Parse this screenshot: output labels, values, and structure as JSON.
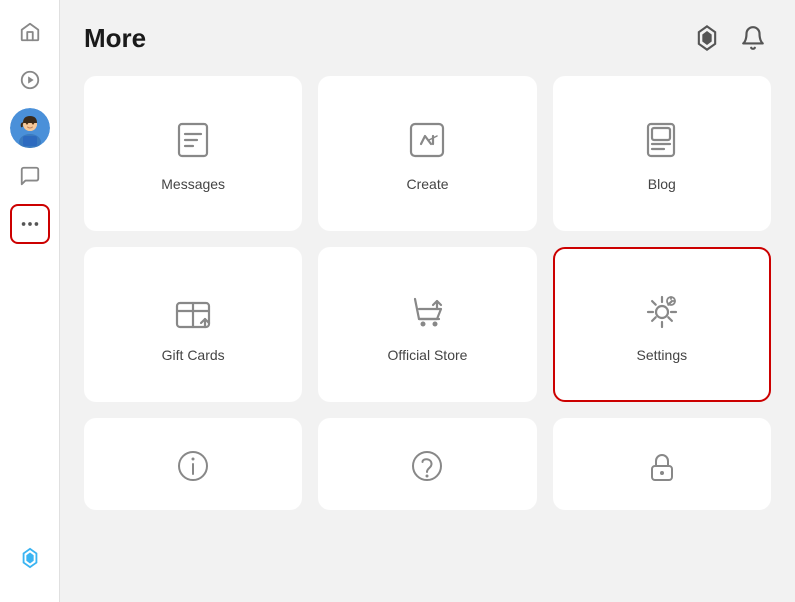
{
  "header": {
    "title": "More"
  },
  "sidebar": {
    "items": [
      {
        "name": "home",
        "label": "Home"
      },
      {
        "name": "discover",
        "label": "Discover"
      },
      {
        "name": "avatar",
        "label": "Avatar"
      },
      {
        "name": "chat",
        "label": "Chat"
      },
      {
        "name": "more",
        "label": "More"
      }
    ],
    "bottom": [
      {
        "name": "robux",
        "label": "Robux"
      }
    ]
  },
  "grid": {
    "cards": [
      {
        "id": "messages",
        "label": "Messages",
        "icon": "messages-icon",
        "highlighted": false
      },
      {
        "id": "create",
        "label": "Create",
        "icon": "create-icon",
        "highlighted": false
      },
      {
        "id": "blog",
        "label": "Blog",
        "icon": "blog-icon",
        "highlighted": false
      },
      {
        "id": "gift-cards",
        "label": "Gift Cards",
        "icon": "gift-cards-icon",
        "highlighted": false
      },
      {
        "id": "official-store",
        "label": "Official Store",
        "icon": "official-store-icon",
        "highlighted": false
      },
      {
        "id": "settings",
        "label": "Settings",
        "icon": "settings-icon",
        "highlighted": true
      },
      {
        "id": "info",
        "label": "",
        "icon": "info-icon",
        "highlighted": false
      },
      {
        "id": "help",
        "label": "",
        "icon": "help-icon",
        "highlighted": false
      },
      {
        "id": "lock",
        "label": "",
        "icon": "lock-icon",
        "highlighted": false
      }
    ]
  }
}
